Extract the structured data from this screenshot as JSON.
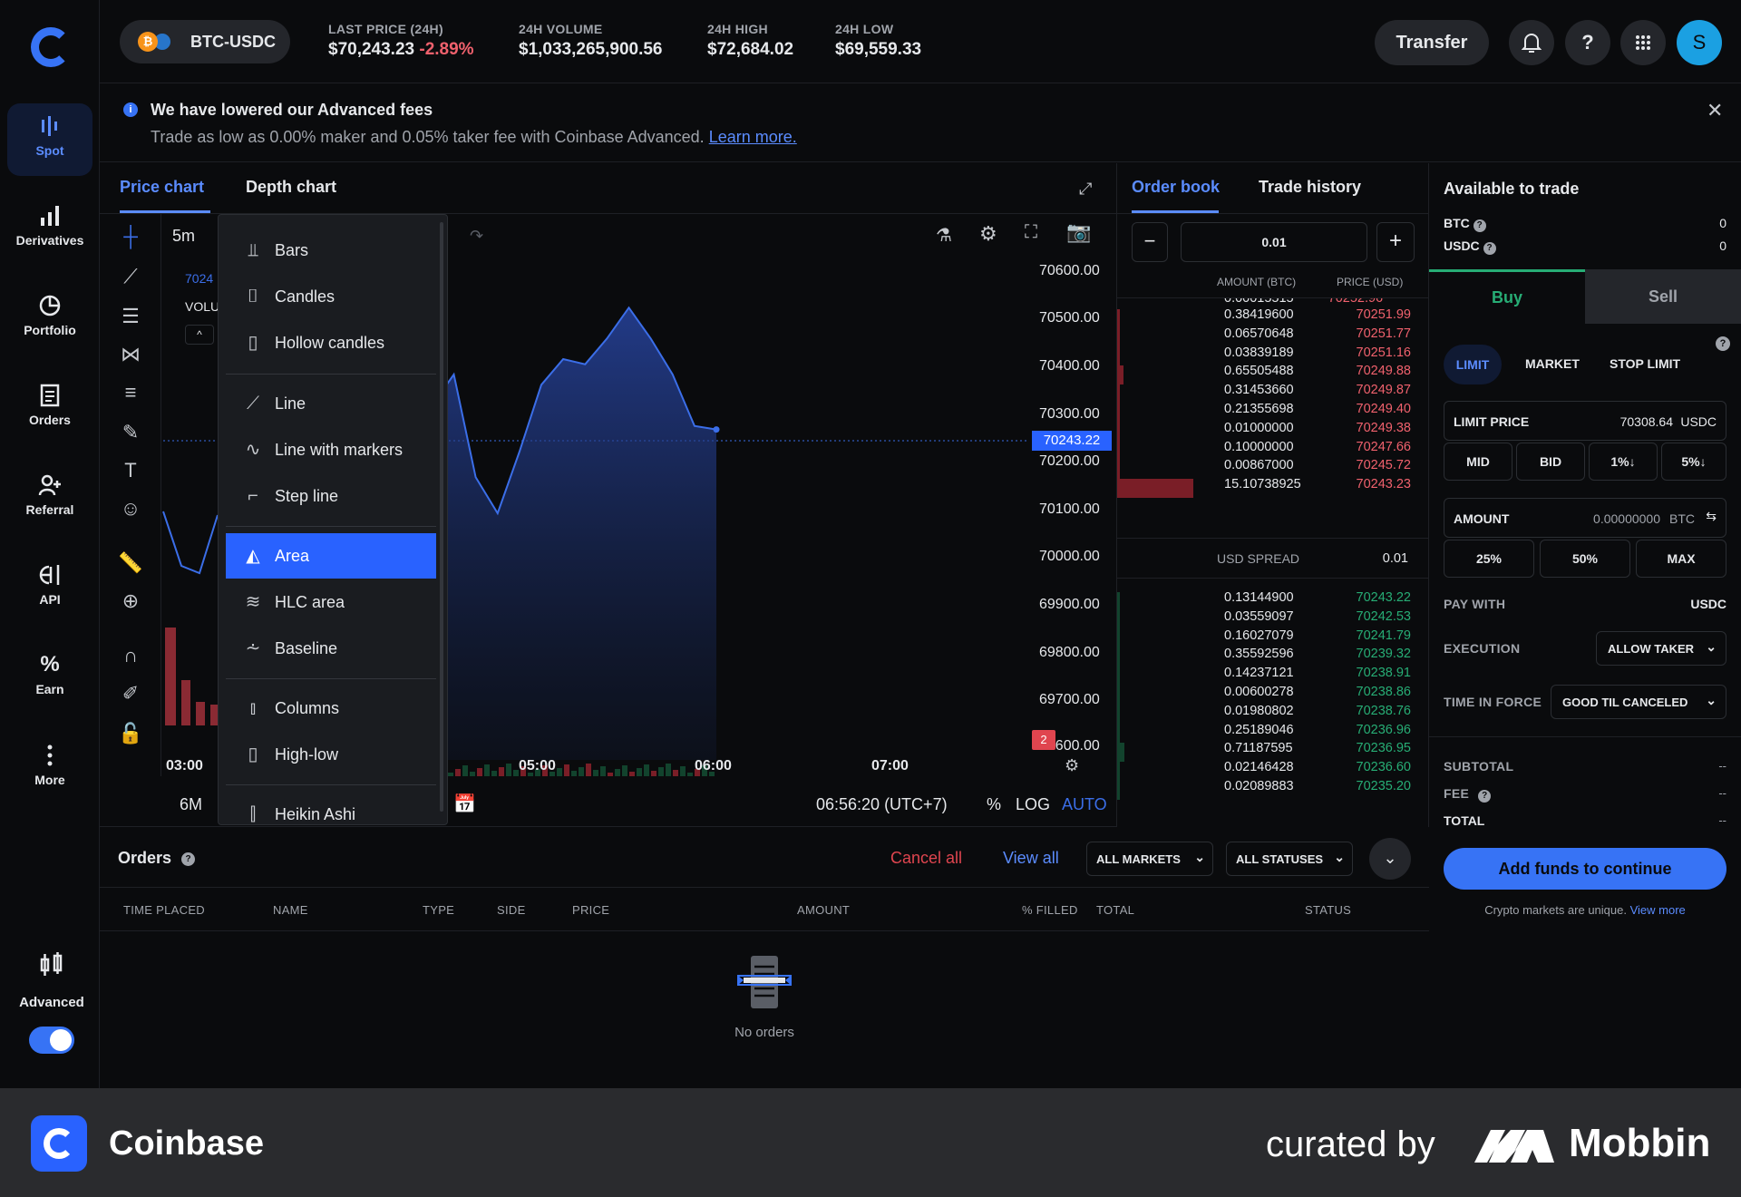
{
  "sidebar": {
    "items": [
      {
        "label": "Spot",
        "icon": "spot-icon"
      },
      {
        "label": "Derivatives",
        "icon": "bar-chart-icon"
      },
      {
        "label": "Portfolio",
        "icon": "pie-chart-icon"
      },
      {
        "label": "Orders",
        "icon": "document-icon"
      },
      {
        "label": "Referral",
        "icon": "add-user-icon"
      },
      {
        "label": "API",
        "icon": "api-icon"
      },
      {
        "label": "Earn",
        "icon": "percent-icon"
      },
      {
        "label": "More",
        "icon": "dots-vertical-icon"
      }
    ],
    "advanced_label": "Advanced",
    "advanced_toggle": "on"
  },
  "header": {
    "pair": "BTC-USDC",
    "last_price_label": "LAST PRICE (24H)",
    "last_price": "$70,243.23",
    "change": "-2.89%",
    "volume_label": "24H VOLUME",
    "volume": "$1,033,265,900.56",
    "high_label": "24H HIGH",
    "high": "$72,684.02",
    "low_label": "24H LOW",
    "low": "$69,559.33",
    "transfer": "Transfer",
    "help": "?",
    "avatar": "S"
  },
  "banner": {
    "title": "We have lowered our Advanced fees",
    "text": "Trade as low as 0.00% maker and 0.05% taker fee with Coinbase Advanced.",
    "link": "Learn more."
  },
  "chart": {
    "tabs": [
      "Price chart",
      "Depth chart"
    ],
    "interval": "5m",
    "price_tag_partial": "7024",
    "volume_partial": "VOLU",
    "range": "6M",
    "time_readout": "06:56:20 (UTC+7)",
    "percent": "%",
    "log": "LOG",
    "auto": "AUTO",
    "current_price": "70243.22",
    "event_badge": "2",
    "dropdown": [
      {
        "label": "Bars",
        "icon": "bars-icon"
      },
      {
        "label": "Candles",
        "icon": "candles-icon"
      },
      {
        "label": "Hollow candles",
        "icon": "hollow-candles-icon"
      },
      {
        "label": "Line",
        "icon": "line-icon"
      },
      {
        "label": "Line with markers",
        "icon": "line-markers-icon"
      },
      {
        "label": "Step line",
        "icon": "step-line-icon"
      },
      {
        "label": "Area",
        "icon": "area-icon",
        "selected": true
      },
      {
        "label": "HLC area",
        "icon": "hlc-area-icon"
      },
      {
        "label": "Baseline",
        "icon": "baseline-icon"
      },
      {
        "label": "Columns",
        "icon": "columns-icon"
      },
      {
        "label": "High-low",
        "icon": "high-low-icon"
      },
      {
        "label": "Heikin Ashi",
        "icon": "heikin-ashi-icon"
      }
    ]
  },
  "chart_data": {
    "type": "area",
    "y_ticks": [
      "70600.00",
      "70500.00",
      "70400.00",
      "70300.00",
      "70200.00",
      "70100.00",
      "70000.00",
      "69900.00",
      "69800.00",
      "69700.00",
      "69600.00"
    ],
    "x_ticks": [
      "03:00",
      "05:00",
      "06:00",
      "07:00"
    ],
    "ylim": [
      69600,
      70650
    ],
    "x": [
      "04:20",
      "04:30",
      "04:40",
      "04:50",
      "05:00",
      "05:10",
      "05:20",
      "05:30",
      "05:40",
      "05:50",
      "06:00",
      "06:10",
      "06:20",
      "06:30",
      "06:40",
      "06:50",
      "06:56"
    ],
    "values": [
      70140,
      70230,
      70400,
      70290,
      70350,
      70150,
      70080,
      70200,
      70330,
      70380,
      70370,
      70420,
      70480,
      70420,
      70350,
      70250,
      70243
    ],
    "series_color": "#3b6ee8",
    "grid": false
  },
  "orderbook": {
    "tabs": [
      "Order book",
      "Trade history"
    ],
    "increment": "0.01",
    "col_amount": "AMOUNT (BTC)",
    "col_price": "PRICE (USD)",
    "asks": [
      {
        "amt": "0.38419600",
        "price": "70251.99",
        "bar": 4
      },
      {
        "amt": "0.06570648",
        "price": "70251.77",
        "bar": 1
      },
      {
        "amt": "0.03839189",
        "price": "70251.16",
        "bar": 1
      },
      {
        "amt": "0.65505488",
        "price": "70249.88",
        "bar": 8
      },
      {
        "amt": "0.31453660",
        "price": "70249.87",
        "bar": 4
      },
      {
        "amt": "0.21355698",
        "price": "70249.40",
        "bar": 3
      },
      {
        "amt": "0.01000000",
        "price": "70249.38",
        "bar": 1
      },
      {
        "amt": "0.10000000",
        "price": "70247.66",
        "bar": 1
      },
      {
        "amt": "0.00867000",
        "price": "70245.72",
        "bar": 1
      },
      {
        "amt": "15.10738925",
        "price": "70243.23",
        "bar": 100
      }
    ],
    "spread_label": "USD SPREAD",
    "spread": "0.01",
    "bids": [
      {
        "amt": "0.13144900",
        "price": "70243.22",
        "bar": 2
      },
      {
        "amt": "0.03559097",
        "price": "70242.53",
        "bar": 1
      },
      {
        "amt": "0.16027079",
        "price": "70241.79",
        "bar": 2
      },
      {
        "amt": "0.35592596",
        "price": "70239.32",
        "bar": 4
      },
      {
        "amt": "0.14237121",
        "price": "70238.91",
        "bar": 2
      },
      {
        "amt": "0.00600278",
        "price": "70238.86",
        "bar": 1
      },
      {
        "amt": "0.01980802",
        "price": "70238.76",
        "bar": 1
      },
      {
        "amt": "0.25189046",
        "price": "70236.96",
        "bar": 3
      },
      {
        "amt": "0.71187595",
        "price": "70236.95",
        "bar": 9
      },
      {
        "amt": "0.02146428",
        "price": "70236.60",
        "bar": 1
      },
      {
        "amt": "0.02089883",
        "price": "70235.20",
        "bar": 1
      }
    ]
  },
  "trade": {
    "available_title": "Available to trade",
    "btc": "BTC",
    "btc_val": "0",
    "usdc": "USDC",
    "usdc_val": "0",
    "buy": "Buy",
    "sell": "Sell",
    "order_types": [
      "LIMIT",
      "MARKET",
      "STOP LIMIT"
    ],
    "limit_price_label": "LIMIT PRICE",
    "limit_price": "70308.64",
    "limit_unit": "USDC",
    "limit_chips": [
      "MID",
      "BID",
      "1%↓",
      "5%↓"
    ],
    "amount_label": "AMOUNT",
    "amount": "0.00000000",
    "amount_unit": "BTC",
    "amount_chips": [
      "25%",
      "50%",
      "MAX"
    ],
    "pay_with_label": "PAY WITH",
    "pay_with": "USDC",
    "execution_label": "EXECUTION",
    "execution": "ALLOW TAKER",
    "tif_label": "TIME IN FORCE",
    "tif": "GOOD TIL CANCELED",
    "subtotal_label": "SUBTOTAL",
    "subtotal": "--",
    "fee_label": "FEE",
    "fee": "--",
    "total_label": "TOTAL",
    "total": "--",
    "cta": "Add funds to continue",
    "note": "Crypto markets are unique.",
    "note_link": "View more"
  },
  "orders": {
    "title": "Orders",
    "cancel_all": "Cancel all",
    "view_all": "View all",
    "markets_filter": "ALL MARKETS",
    "status_filter": "ALL STATUSES",
    "columns": [
      "TIME PLACED",
      "NAME",
      "TYPE",
      "SIDE",
      "PRICE",
      "AMOUNT",
      "% FILLED",
      "TOTAL",
      "STATUS"
    ],
    "empty": "No orders"
  },
  "footer": {
    "brand": "Coinbase",
    "curated": "curated by",
    "mobbin": "Mobbin"
  }
}
